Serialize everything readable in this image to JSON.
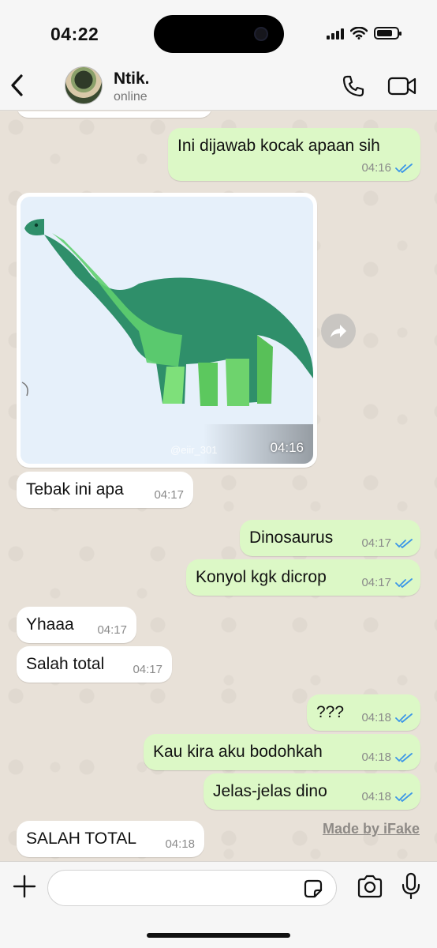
{
  "status_bar": {
    "time": "04:22"
  },
  "header": {
    "contact_name": "Ntik.",
    "contact_status": "online"
  },
  "messages": [
    {
      "dir": "out",
      "text": "Ini dijawab kocak apaan sih",
      "time": "04:16",
      "read": true
    },
    {
      "dir": "in",
      "type": "image",
      "watermark": "@eiir_301",
      "time": "04:16"
    },
    {
      "dir": "in",
      "text": "Tebak ini apa",
      "time": "04:17"
    },
    {
      "dir": "out",
      "text": "Dinosaurus",
      "time": "04:17",
      "read": true
    },
    {
      "dir": "out",
      "text": "Konyol kgk dicrop",
      "time": "04:17",
      "read": true
    },
    {
      "dir": "in",
      "text": "Yhaaa",
      "time": "04:17"
    },
    {
      "dir": "in",
      "text": "Salah total",
      "time": "04:17"
    },
    {
      "dir": "out",
      "text": "???",
      "time": "04:18",
      "read": true
    },
    {
      "dir": "out",
      "text": "Kau kira aku bodohkah",
      "time": "04:18",
      "read": true
    },
    {
      "dir": "out",
      "text": "Jelas-jelas dino",
      "time": "04:18",
      "read": true
    },
    {
      "dir": "in",
      "text": "SALAH TOTAL",
      "time": "04:18"
    }
  ],
  "watermark": "Made by iFake",
  "input": {
    "value": "",
    "placeholder": ""
  },
  "icons": {
    "back": "chevron-left-icon",
    "call": "phone-icon",
    "video": "video-camera-icon",
    "forward": "forward-arrow-icon",
    "attach": "plus-icon",
    "sticker": "sticker-icon",
    "camera": "camera-icon",
    "mic": "microphone-icon"
  },
  "colors": {
    "outgoing_bubble": "#dcf8c6",
    "incoming_bubble": "#ffffff",
    "read_ticks": "#3b96e8",
    "chat_bg": "#e8e1d8"
  }
}
